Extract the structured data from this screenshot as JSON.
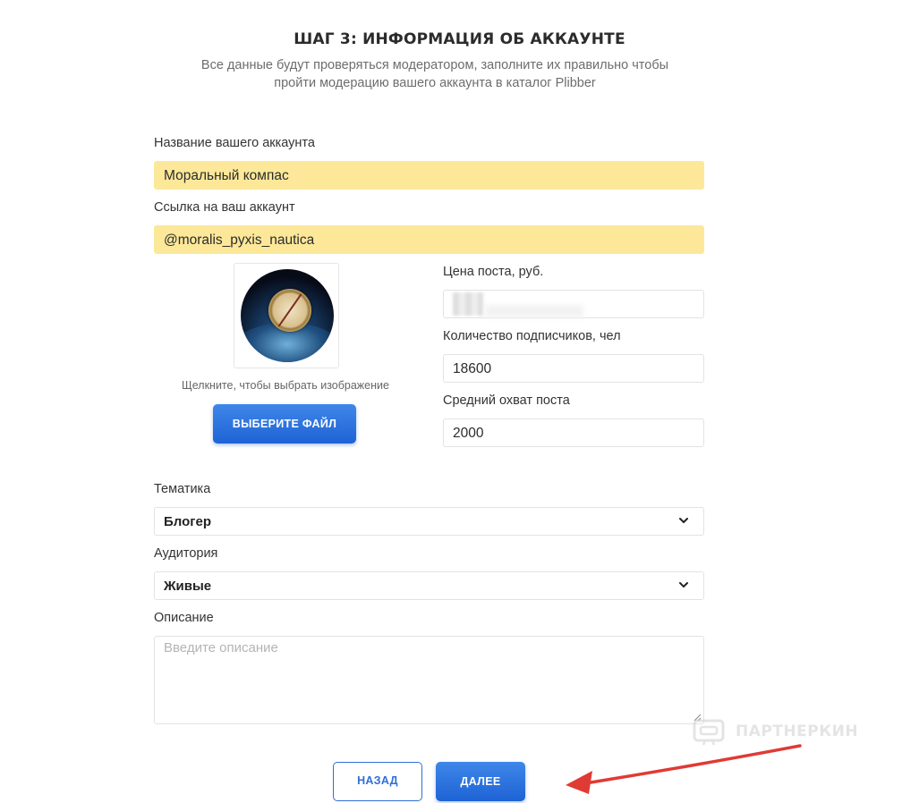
{
  "header": {
    "title": "ШАГ 3: ИНФОРМАЦИЯ ОБ АККАУНТЕ",
    "subtitle_line1": "Все данные будут проверяться модератором, заполните их правильно чтобы",
    "subtitle_line2": "пройти модерацию вашего аккаунта в каталог Plibber"
  },
  "form": {
    "account_name": {
      "label": "Название вашего аккаунта",
      "value": "Моральный компас"
    },
    "account_link": {
      "label": "Ссылка на ваш аккаунт",
      "value": "@moralis_pyxis_nautica"
    },
    "post_price": {
      "label": "Цена поста, руб.",
      "value": ""
    },
    "subscribers": {
      "label": "Количество подписчиков, чел",
      "value": "18600"
    },
    "avg_reach": {
      "label": "Средний охват поста",
      "value": "2000"
    },
    "image_hint": "Щелкните, чтобы выбрать изображение",
    "choose_file_label": "ВЫБЕРИТЕ ФАЙЛ",
    "topic": {
      "label": "Тематика",
      "selected": "Блогер"
    },
    "audience": {
      "label": "Аудитория",
      "selected": "Живые"
    },
    "description": {
      "label": "Описание",
      "placeholder": "Введите описание"
    }
  },
  "actions": {
    "back_label": "НАЗАД",
    "next_label": "ДАЛЕЕ"
  },
  "watermark": {
    "text": "ПАРТНЕРКИН"
  },
  "colors": {
    "highlight": "#fde899",
    "primary": "#2f6fd8",
    "arrow": "#e03a35"
  },
  "icons": {
    "chevron": "chevron-down-icon",
    "arrow": "red-arrow-annotation"
  }
}
